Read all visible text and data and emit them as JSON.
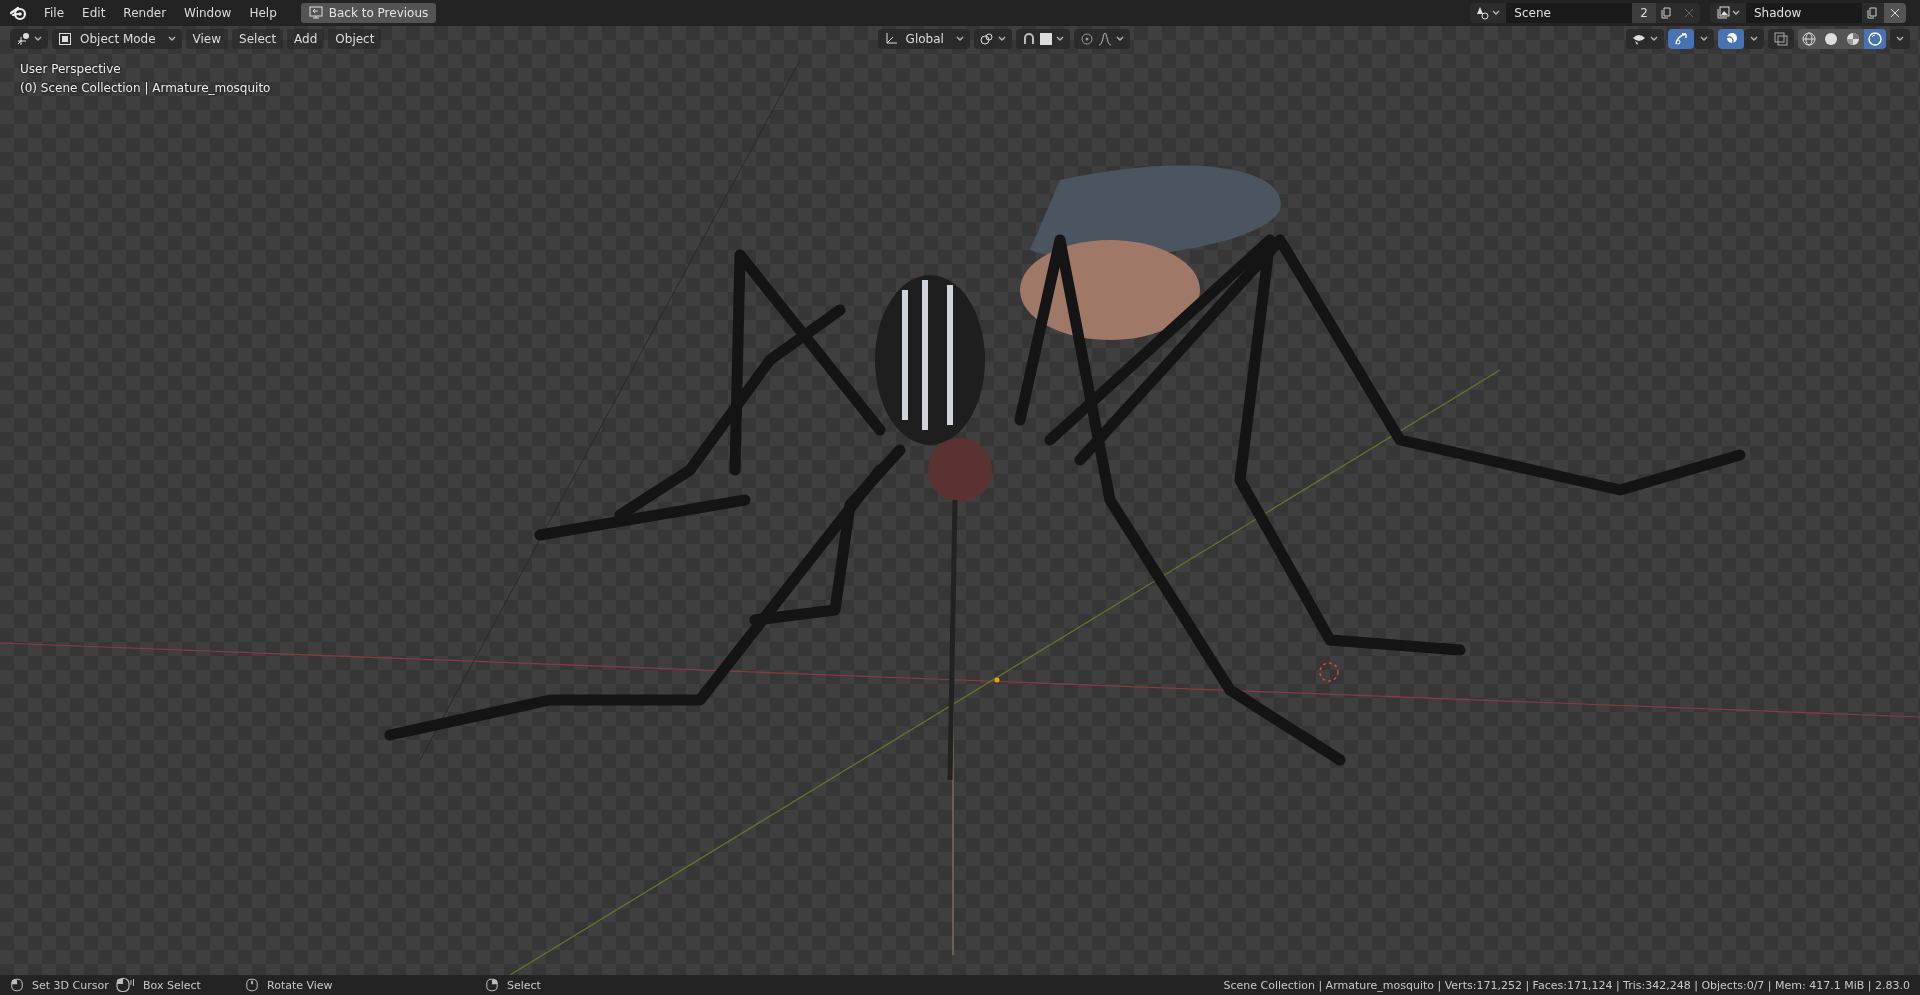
{
  "topbar": {
    "menus": [
      "File",
      "Edit",
      "Render",
      "Window",
      "Help"
    ],
    "back_button": "Back to Previous",
    "scene": {
      "name": "Scene",
      "users": "2"
    },
    "view_layer": {
      "name": "Shadow"
    }
  },
  "header": {
    "mode": "Object Mode",
    "menus": [
      "View",
      "Select",
      "Add",
      "Object"
    ],
    "orientation": "Global",
    "toggles": [
      {
        "kind": "gizmos",
        "on": true
      },
      {
        "kind": "overlays",
        "on": true
      }
    ],
    "shading": [
      {
        "kind": "wireframe",
        "selected": false
      },
      {
        "kind": "solid",
        "selected": false
      },
      {
        "kind": "material",
        "selected": false
      },
      {
        "kind": "rendered",
        "selected": true
      }
    ]
  },
  "viewport": {
    "overlay_lines": [
      "User Perspective",
      "(0) Scene Collection | Armature_mosquito"
    ]
  },
  "status_bar": {
    "hints": [
      {
        "kind": "left",
        "label": "Set 3D Cursor"
      },
      {
        "kind": "drag",
        "label": "Box Select"
      },
      {
        "kind": "middle",
        "label": "Rotate View"
      },
      {
        "kind": "right",
        "label": "Select"
      }
    ],
    "stats": "Scene Collection | Armature_mosquito | Verts:171,252 | Faces:171,124 | Tris:342,248 | Objects:0/7 | Mem: 417.1 MiB | 2.83.0"
  }
}
